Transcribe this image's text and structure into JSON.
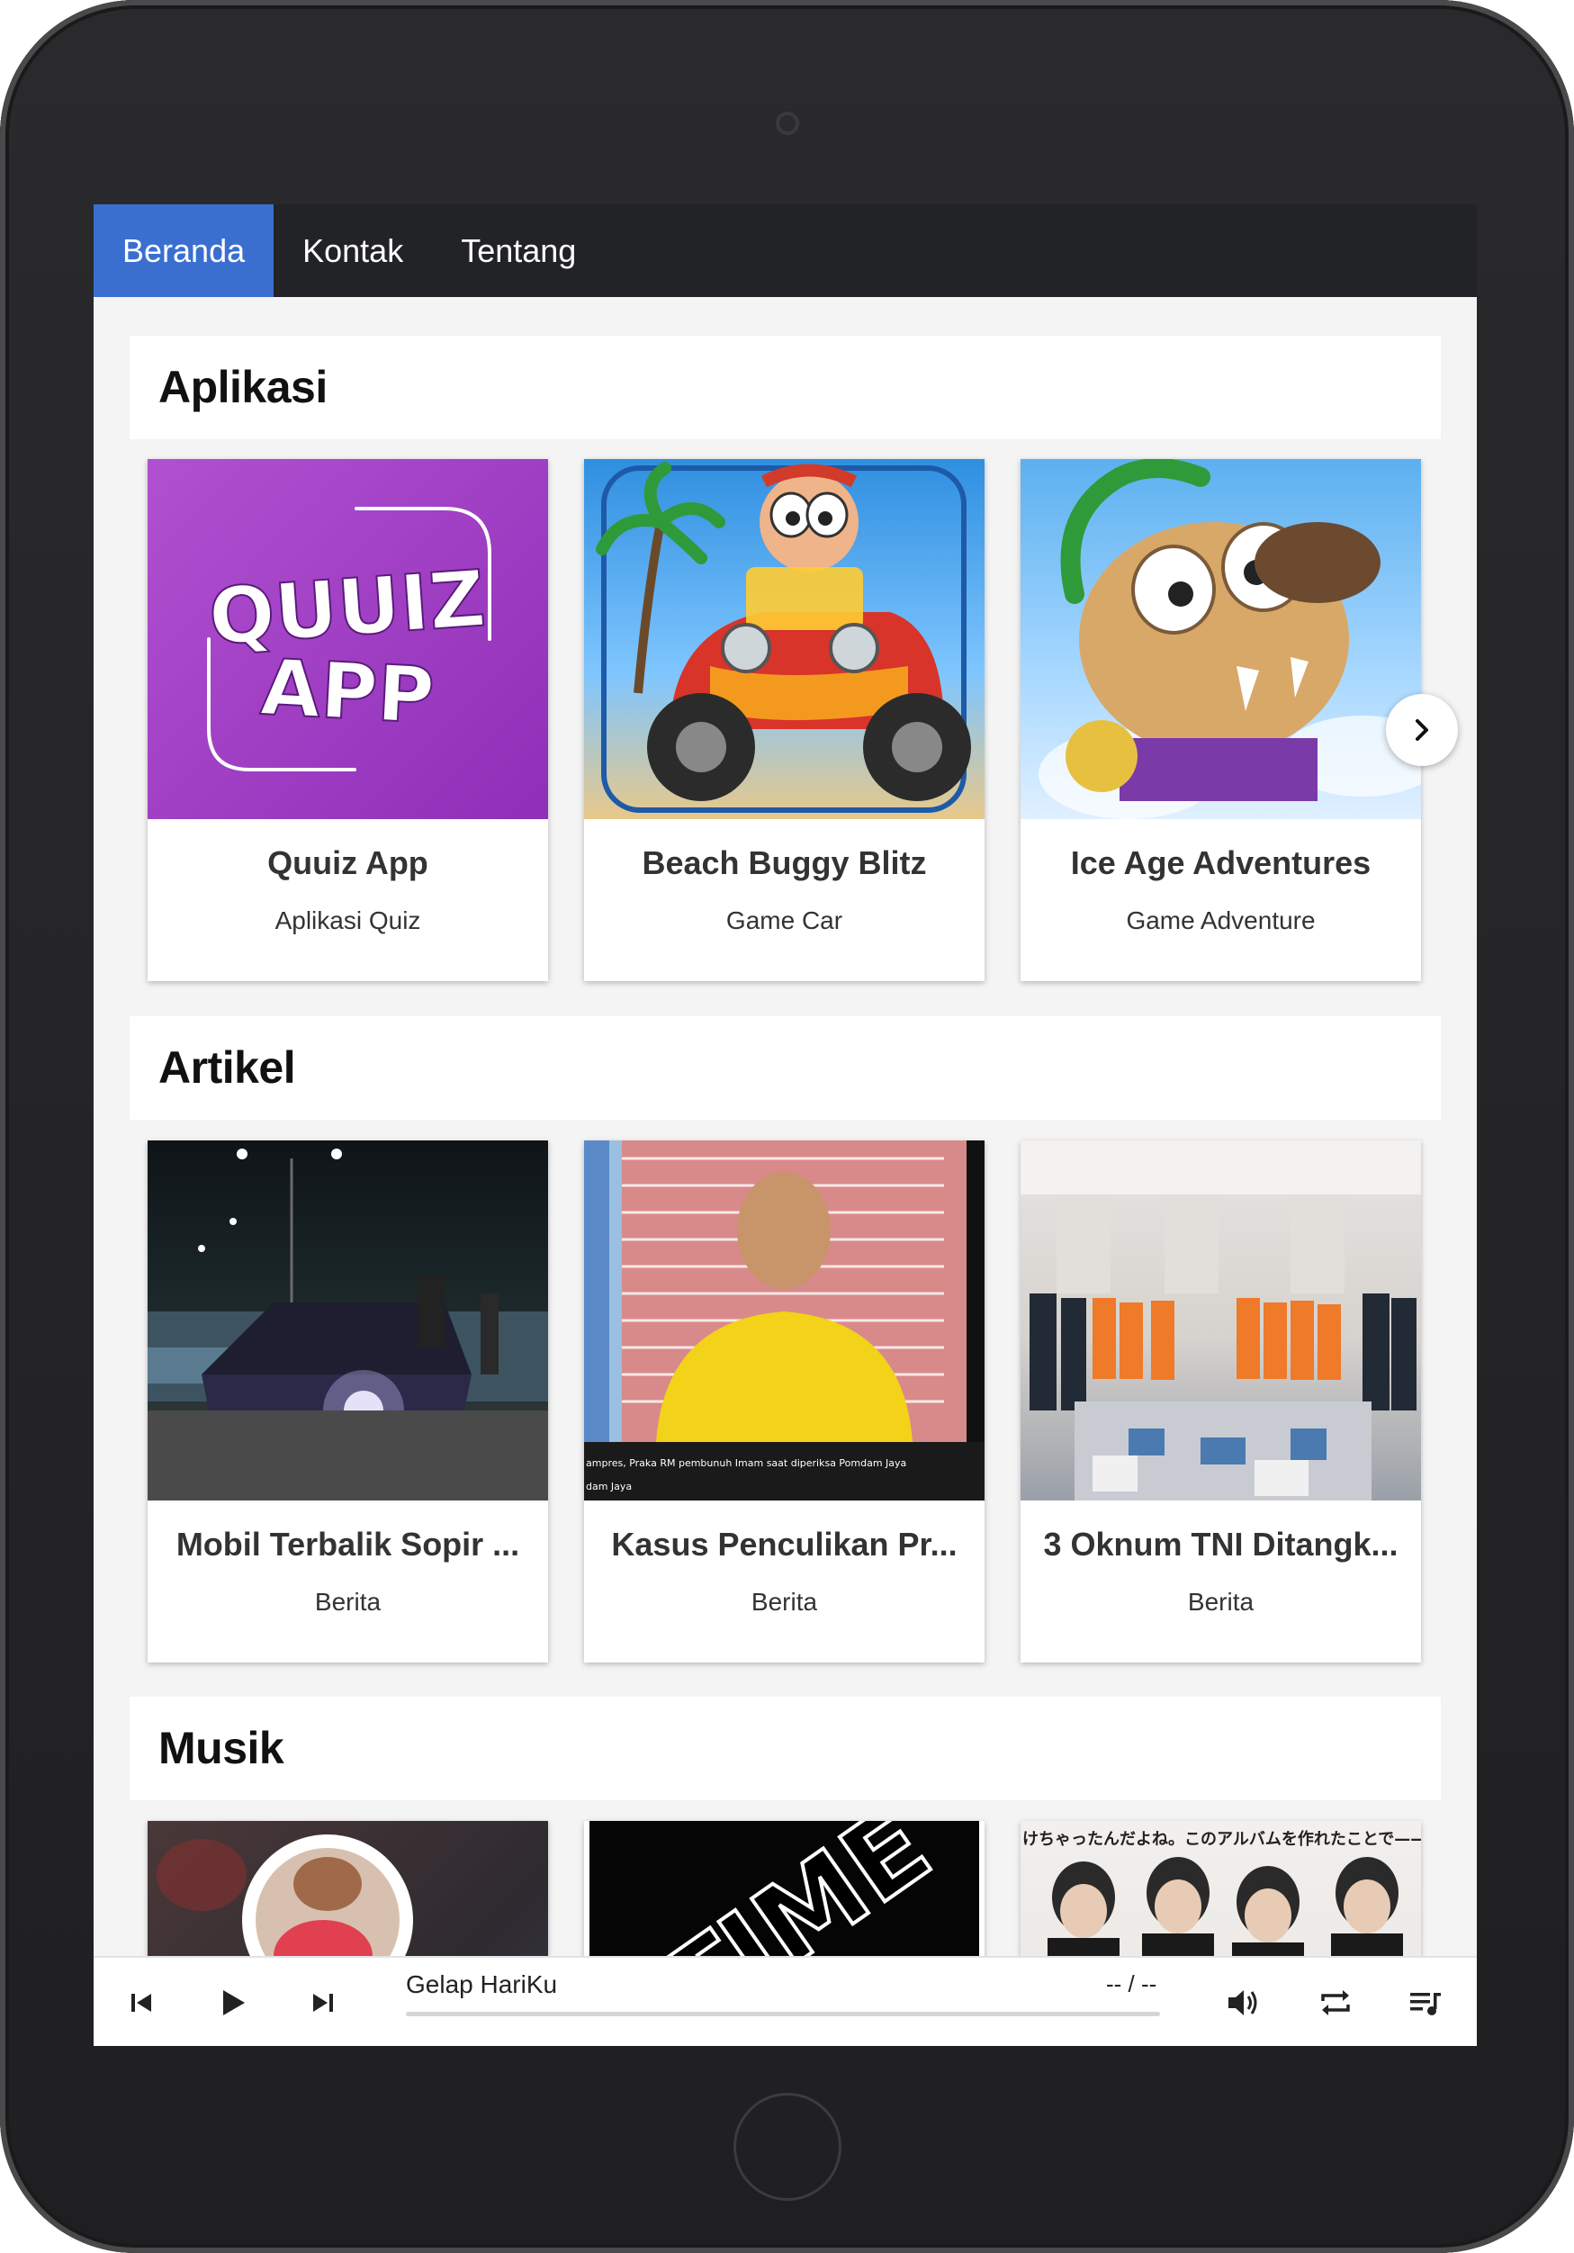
{
  "nav": {
    "items": [
      {
        "label": "Beranda",
        "active": true
      },
      {
        "label": "Kontak",
        "active": false
      },
      {
        "label": "Tentang",
        "active": false
      }
    ]
  },
  "sections": {
    "apps": {
      "title": "Aplikasi",
      "cards": [
        {
          "title": "Quuiz App",
          "subtitle": "Aplikasi Quiz",
          "logo_line1": "QUUIZ",
          "logo_line2": "APP"
        },
        {
          "title": "Beach Buggy Blitz",
          "subtitle": "Game Car"
        },
        {
          "title": "Ice Age Adventures",
          "subtitle": "Game Adventure"
        }
      ]
    },
    "articles": {
      "title": "Artikel",
      "cards": [
        {
          "title": "Mobil Terbalik Sopir ...",
          "subtitle": "Berita"
        },
        {
          "title": "Kasus Penculikan Pr...",
          "subtitle": "Berita",
          "caption_line1": "ampres, Praka RM pembunuh Imam saat diperiksa Pomdam Jaya",
          "caption_line2": "dam Jaya"
        },
        {
          "title": "3 Oknum TNI Ditangk...",
          "subtitle": "Berita"
        }
      ]
    },
    "music": {
      "title": "Musik",
      "cards": [
        {},
        {
          "image_text": "TIME"
        },
        {
          "image_text": "けちゃったんだよね。このアルバムを作れたことで——"
        }
      ]
    }
  },
  "player": {
    "track_title": "Gelap HariKu",
    "time": "-- / --",
    "progress": 0
  },
  "colors": {
    "nav_bg": "#222326",
    "nav_active": "#3a6fd0",
    "quiz_bg": "#9b3bc0"
  }
}
